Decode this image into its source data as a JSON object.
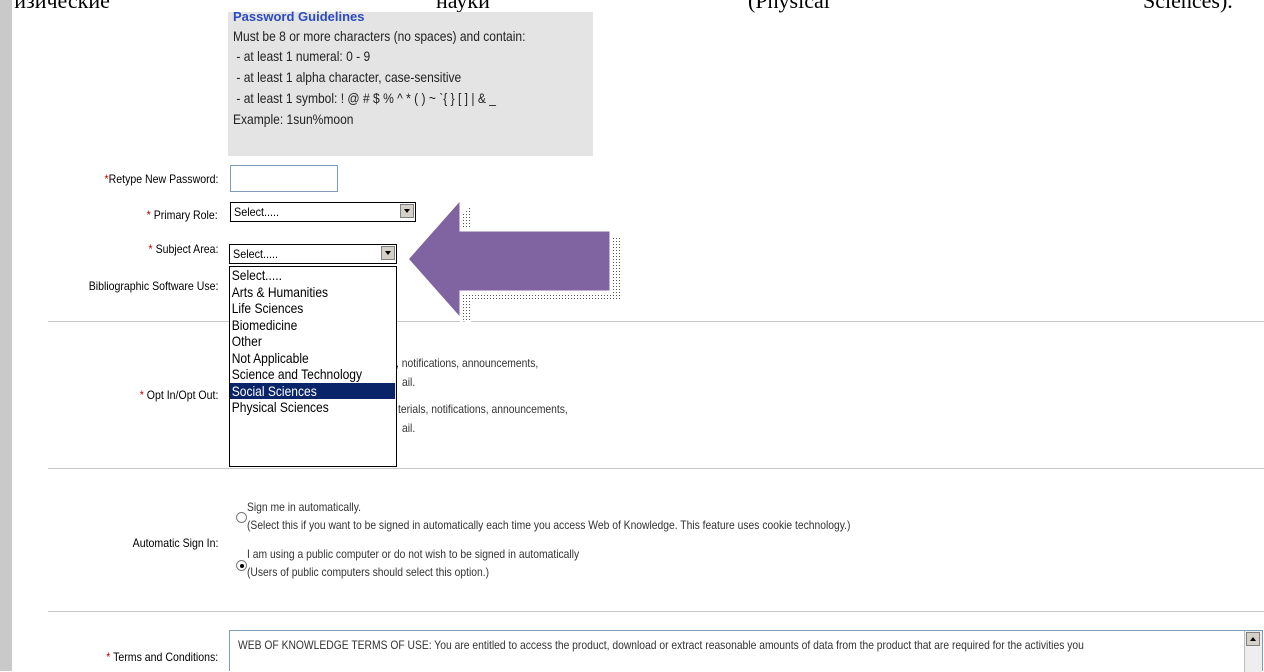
{
  "caption": {
    "word1": "физические",
    "word2": "науки",
    "word3": "(Physical",
    "word4": "Sciences)."
  },
  "guidelines": {
    "title": "Password Guidelines",
    "lines": [
      "Must be 8 or more characters (no spaces) and contain:",
      " - at least 1 numeral: 0 - 9",
      " - at least 1 alpha character, case-sensitive",
      " - at least 1 symbol: ! @ # $ % ^ * ( ) ~ `{ } [ ] | & _",
      "Example: 1sun%moon"
    ]
  },
  "form": {
    "retype_label": "Retype New Password:",
    "primary_role_label": "Primary Role:",
    "primary_role_value": "Select.....",
    "subject_area_label": "Subject Area:",
    "subject_area_value": "Select.....",
    "bib_label": "Bibliographic Software Use:",
    "opt_label": "Opt In/Opt Out:",
    "auto_label": "Automatic Sign In:",
    "terms_label": "Terms and Conditions:",
    "required_mark": "*"
  },
  "dropdown": {
    "options": [
      "Select.....",
      "Arts & Humanities",
      "Life Sciences",
      "Biomedicine",
      "Other",
      "Not Applicable",
      "Science and Technology",
      "Social Sciences",
      "Physical Sciences"
    ],
    "highlighted_index": 7
  },
  "opt_in": {
    "line1_fragment": ", notifications, announcements,",
    "line2_fragment": "ail.",
    "line3_fragment": "terials, notifications, announcements,",
    "line4_fragment": "ail."
  },
  "auto_sign_in": {
    "option1_title": "Sign me in automatically.",
    "option1_desc": "(Select this if you want to be signed in automatically each time you access Web of Knowledge. This feature uses cookie technology.)",
    "option2_title": "I am using a public computer or do not wish to be signed in automatically",
    "option2_desc": "(Users of public computers should select this option.)",
    "selected": 2
  },
  "terms": {
    "text": "WEB OF KNOWLEDGE TERMS OF USE: You are entitled to access the product, download or extract reasonable amounts of data from the product that are required for the activities you"
  },
  "colors": {
    "arrow_fill": "#8064a2",
    "guidelines_bg": "#e4e4e4",
    "highlight": "#0a246a",
    "required": "#c00000"
  }
}
